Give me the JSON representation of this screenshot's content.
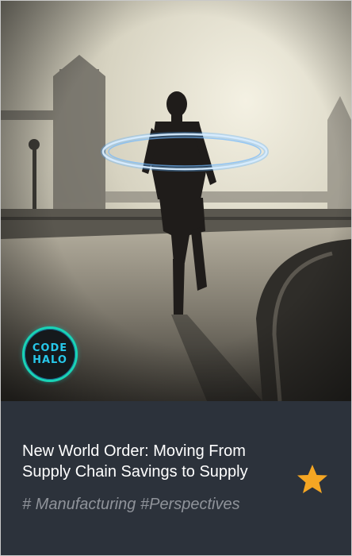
{
  "card": {
    "title": "New World Order: Moving From Supply Chain Savings to Supply",
    "tags": "# Manufacturing #Perspectives",
    "badge": {
      "line1": "CODE",
      "line2": "HALO"
    },
    "icons": {
      "favorite": "star-icon",
      "logo": "code-halo-logo"
    }
  },
  "colors": {
    "info_background": "#2c323b",
    "title_text": "#ffffff",
    "tags_text": "#8f939a",
    "star": "#f5a623",
    "badge_ring": "#19d3b6",
    "badge_text": "#27c7e9"
  }
}
